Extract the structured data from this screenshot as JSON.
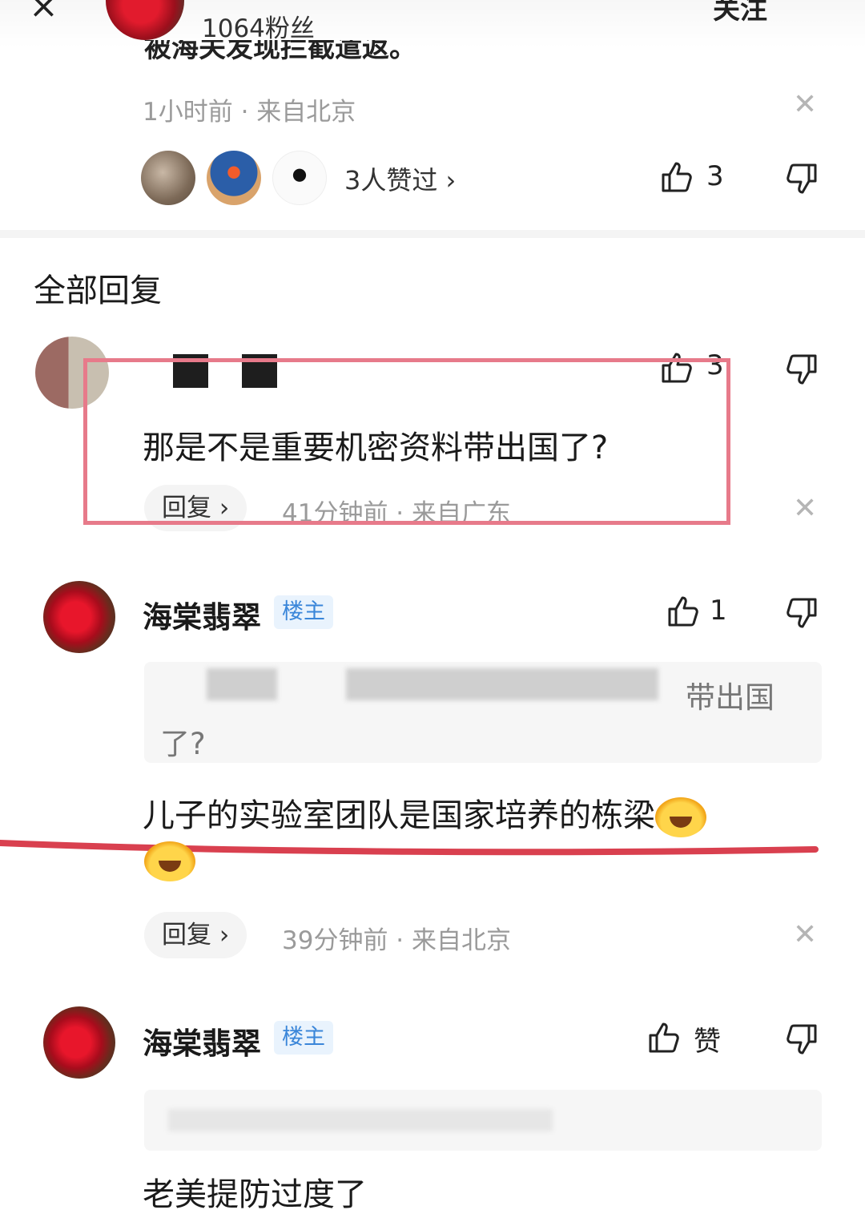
{
  "header": {
    "fans_text": "1064粉丝",
    "follow_label": "关注",
    "cutoff_comment": "被海关发现拦截遣返。"
  },
  "top_comment": {
    "meta": "1小时前 · 来自北京",
    "likers_text": "3人赞过",
    "like_count": "3"
  },
  "section_title": "全部回复",
  "replies": [
    {
      "like_count": "3",
      "text": "那是不是重要机密资料带出国了?",
      "reply_label": "回复",
      "meta": "41分钟前 · 来自广东"
    },
    {
      "username": "海棠翡翠",
      "badge": "楼主",
      "like_count": "1",
      "quote_visible_1": "带出国",
      "quote_visible_2": "了?",
      "text": "儿子的实验室团队是国家培养的栋梁",
      "reply_label": "回复",
      "meta": "39分钟前 · 来自北京"
    },
    {
      "username": "海棠翡翠",
      "badge": "楼主",
      "like_label": "赞",
      "text": "老美提防过度了"
    }
  ],
  "colors": {
    "highlight_box": "#e77a8a",
    "annotation_line": "#d9404f",
    "op_badge_text": "#3a86d9"
  }
}
